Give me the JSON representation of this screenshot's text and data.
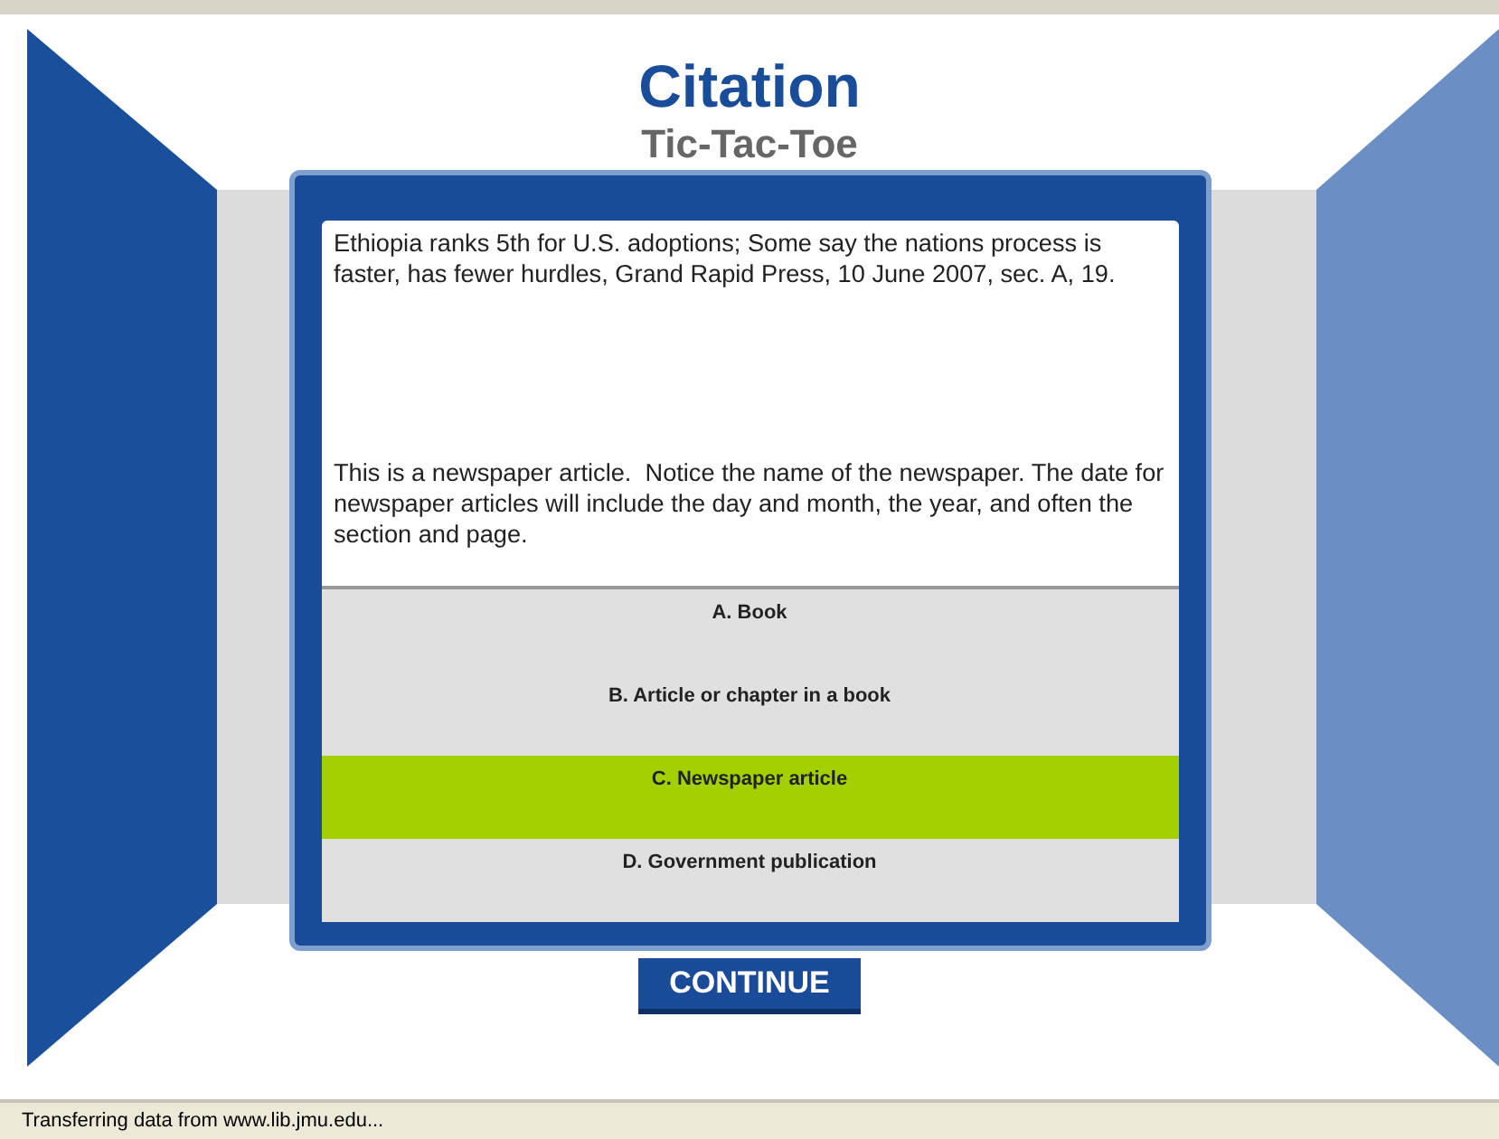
{
  "title": "Citation",
  "subtitle": "Tic-Tac-Toe",
  "dialog": {
    "citation": "Ethiopia ranks 5th for U.S. adoptions; Some say the nations process is faster, has fewer hurdles, Grand Rapid Press, 10 June 2007, sec. A, 19.",
    "explanation": "This is a newspaper article.  Notice the name of the newspaper. The date for newspaper articles will include the day and month, the year, and often the section and page.",
    "options": [
      {
        "label": "A. Book",
        "selected": false
      },
      {
        "label": "B. Article or chapter in a book",
        "selected": false
      },
      {
        "label": "C. Newspaper article",
        "selected": true
      },
      {
        "label": "D. Government publication",
        "selected": false
      }
    ]
  },
  "continue_button": "CONTINUE",
  "status_bar": "Transferring data from www.lib.jmu.edu..."
}
